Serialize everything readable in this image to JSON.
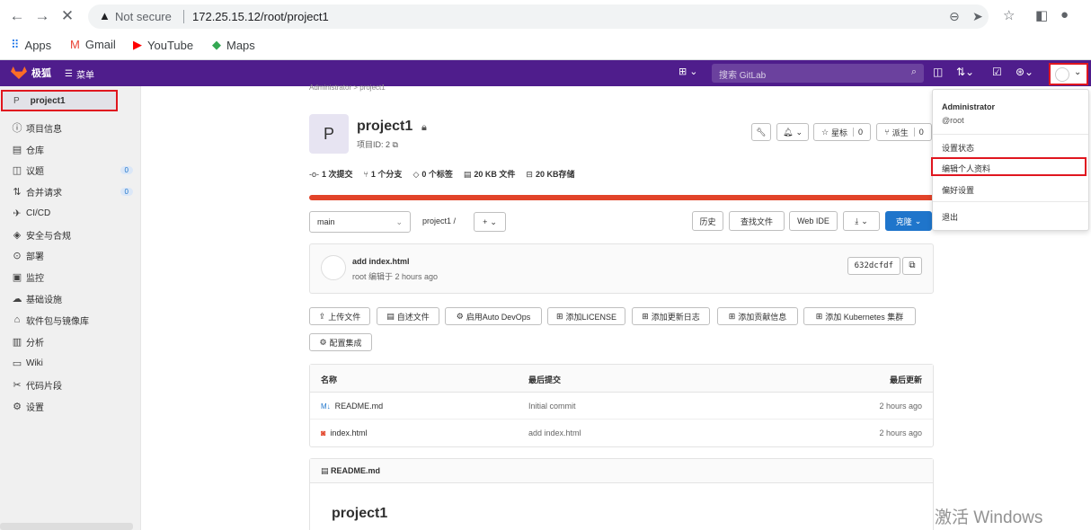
{
  "browser": {
    "not_secure": "Not secure",
    "url": "172.25.15.12/root/project1",
    "bookmarks": [
      "Apps",
      "Gmail",
      "YouTube",
      "Maps"
    ]
  },
  "gitlab": {
    "logo_text": "极狐",
    "menu_label": "菜单",
    "search_placeholder": "搜索 GitLab"
  },
  "sidebar": {
    "project_letter": "P",
    "project_name": "project1",
    "items": [
      {
        "label": "项目信息",
        "icon": "info-icon"
      },
      {
        "label": "仓库",
        "icon": "doc-icon"
      },
      {
        "label": "议题",
        "icon": "issues-icon",
        "count": "0"
      },
      {
        "label": "合并请求",
        "icon": "merge-icon",
        "count": "0"
      },
      {
        "label": "CI/CD",
        "icon": "rocket-icon"
      },
      {
        "label": "安全与合规",
        "icon": "shield-icon"
      },
      {
        "label": "部署",
        "icon": "deploy-icon"
      },
      {
        "label": "监控",
        "icon": "monitor-icon"
      },
      {
        "label": "基础设施",
        "icon": "cloud-icon"
      },
      {
        "label": "软件包与镜像库",
        "icon": "package-icon"
      },
      {
        "label": "分析",
        "icon": "chart-icon"
      },
      {
        "label": "Wiki",
        "icon": "book-icon"
      },
      {
        "label": "代码片段",
        "icon": "scissors-icon"
      },
      {
        "label": "设置",
        "icon": "gear-icon"
      }
    ]
  },
  "project": {
    "breadcrumb": "Administrator > project1",
    "avatar_letter": "P",
    "name": "project1",
    "id_label": "项目ID: 2",
    "star_label": "星标",
    "star_count": "0",
    "fork_label": "派生",
    "fork_count": "0",
    "stats": [
      "1 次提交",
      "1 个分支",
      "0 个标签",
      "20 KB 文件",
      "20 KB存储"
    ]
  },
  "repo": {
    "branch": "main",
    "path": "project1 /",
    "history": "历史",
    "find_file": "查找文件",
    "web_ide": "Web IDE",
    "clone": "克隆",
    "commit_title": "add index.html",
    "commit_meta": "root 编辑于 2 hours ago",
    "sha": "632dcfdf",
    "actions": [
      "上传文件",
      "自述文件",
      "启用Auto DevOps",
      "添加LICENSE",
      "添加更新日志",
      "添加贡献信息",
      "添加 Kubernetes 集群",
      "配置集成"
    ]
  },
  "files": {
    "headers": [
      "名称",
      "最后提交",
      "最后更新"
    ],
    "rows": [
      {
        "name": "README.md",
        "commit": "Initial commit",
        "updated": "2 hours ago"
      },
      {
        "name": "index.html",
        "commit": "add index.html",
        "updated": "2 hours ago"
      }
    ]
  },
  "readme": {
    "file": "README.md",
    "heading": "project1"
  },
  "dropdown": {
    "name": "Administrator",
    "username": "@root",
    "items": [
      "设置状态",
      "编辑个人资料",
      "偏好设置",
      "退出"
    ]
  },
  "watermark": "激活 Windows",
  "colors": {
    "gitlab_nav": "#4f1d8c",
    "highlight": "#e0161f",
    "primary": "#1f75cb",
    "progress": "#e24329"
  }
}
